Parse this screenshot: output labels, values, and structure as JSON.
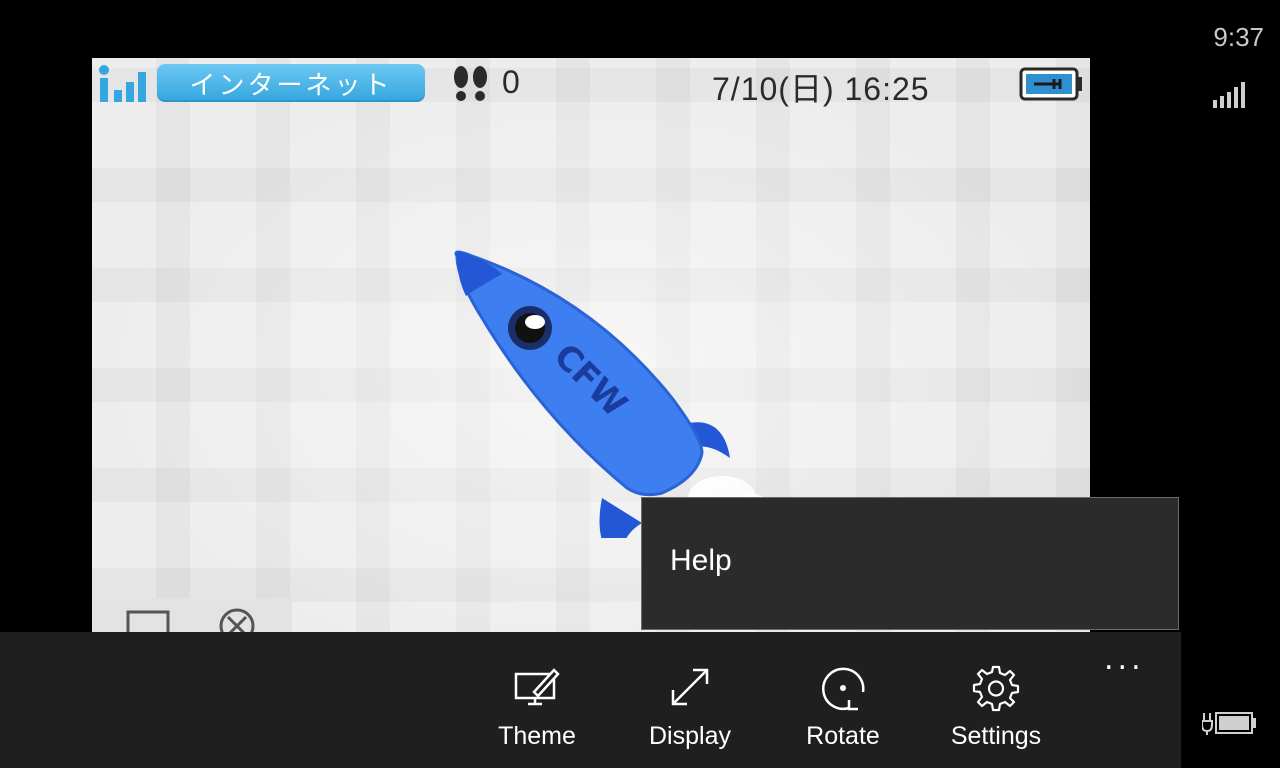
{
  "phone_status": {
    "time": "9:37",
    "signal_icon": "signal-bars-icon",
    "charging_icon": "battery-charging-icon"
  },
  "screen": {
    "network_label": "インターネット",
    "step_count": "0",
    "datetime": "7/10(日) 16:25",
    "rocket_text": "CFW"
  },
  "popup": {
    "items": [
      {
        "label": "Help"
      }
    ]
  },
  "appbar": {
    "buttons": [
      {
        "label": "Theme",
        "icon": "theme-icon"
      },
      {
        "label": "Display",
        "icon": "resize-icon"
      },
      {
        "label": "Rotate",
        "icon": "rotate-icon"
      },
      {
        "label": "Settings",
        "icon": "gear-icon"
      }
    ],
    "more_label": "..."
  },
  "colors": {
    "accent_blue": "#3aa6e0",
    "rocket_blue": "#2a6de0",
    "appbar_bg": "#1f1f1f",
    "popup_bg": "#2b2b2b"
  }
}
